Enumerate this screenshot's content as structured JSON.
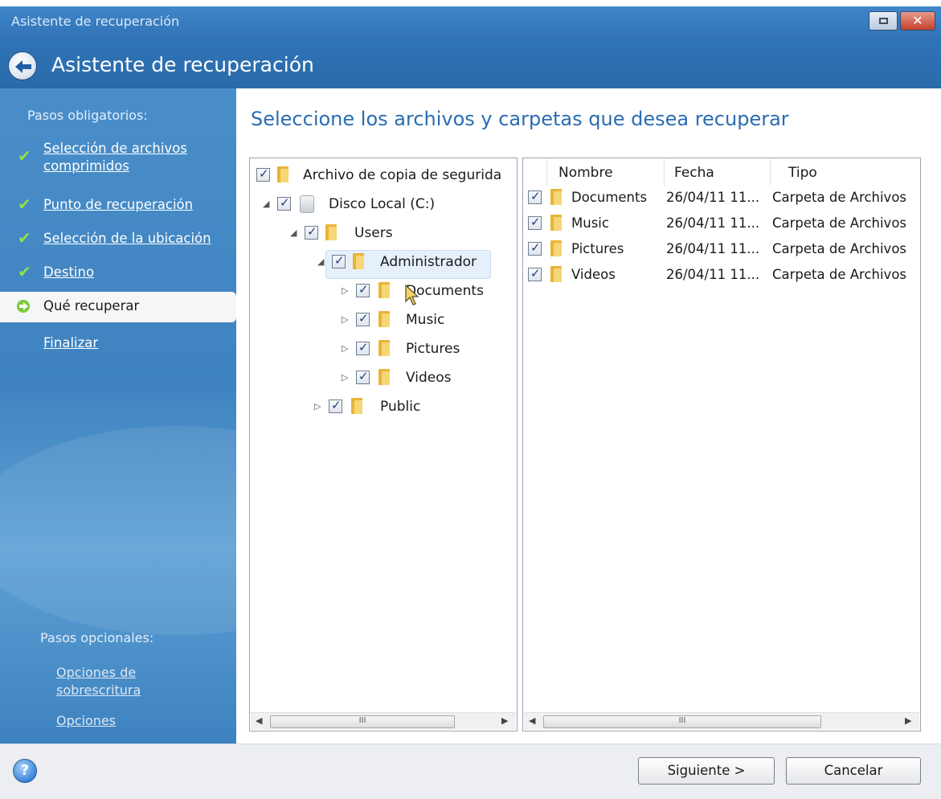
{
  "window": {
    "title": "Asistente de recuperación",
    "header_title": "Asistente de recuperación",
    "controls": [
      "restore-icon",
      "close-icon"
    ]
  },
  "sidebar": {
    "required_label": "Pasos obligatorios:",
    "steps": [
      {
        "label_line1": "Selección de archivos",
        "label_line2": "comprimidos",
        "state": "done"
      },
      {
        "label": "Punto de recuperación",
        "state": "done"
      },
      {
        "label": "Selección de la ubicación",
        "state": "done"
      },
      {
        "label": "Destino",
        "state": "done"
      },
      {
        "label": "Qué recuperar",
        "state": "current"
      },
      {
        "label": "Finalizar",
        "state": "pending"
      }
    ],
    "optional_label": "Pasos opcionales:",
    "optional_steps": [
      {
        "label_line1": "Opciones de",
        "label_line2": "sobrescritura"
      },
      {
        "label": "Opciones"
      }
    ]
  },
  "main": {
    "title": "Seleccione los archivos y carpetas que desea recuperar",
    "tree": {
      "root": "Archivo de copia de segurida",
      "disk": "Disco Local (C:)",
      "users": "Users",
      "admin": "Administrador",
      "children": [
        "Documents",
        "Music",
        "Pictures",
        "Videos"
      ],
      "public": "Public"
    },
    "list": {
      "columns": [
        "Nombre",
        "Fecha",
        "Tipo"
      ],
      "rows": [
        {
          "name": "Documents",
          "date": "26/04/11 11...",
          "type": "Carpeta de Archivos"
        },
        {
          "name": "Music",
          "date": "26/04/11 11...",
          "type": "Carpeta de Archivos"
        },
        {
          "name": "Pictures",
          "date": "26/04/11 11...",
          "type": "Carpeta de Archivos"
        },
        {
          "name": "Videos",
          "date": "26/04/11 11...",
          "type": "Carpeta de Archivos"
        }
      ]
    },
    "scroll_grip": "III"
  },
  "footer": {
    "help": "?",
    "next_label": "Siguiente >",
    "cancel_label": "Cancelar"
  },
  "colors": {
    "title_bar": "#2f72b4",
    "sidebar": "#4a8ec9",
    "accent_title": "#2a6cb3",
    "check_green": "#8fe04c",
    "folder": "#e9b436"
  }
}
